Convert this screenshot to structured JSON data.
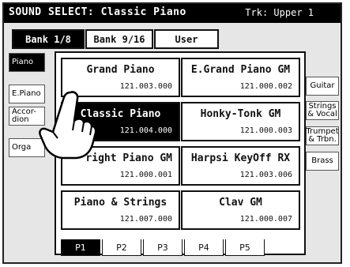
{
  "header": {
    "title": "SOUND SELECT: Classic Piano",
    "track": "Trk: Upper 1"
  },
  "bank_tabs": [
    {
      "label": "Bank 1/8",
      "active": true
    },
    {
      "label": "Bank 9/16",
      "active": false
    },
    {
      "label": "User",
      "active": false
    }
  ],
  "categories_left": [
    {
      "label": "Piano",
      "active": true
    },
    {
      "label": "E.Piano",
      "active": false
    },
    {
      "label": "Accor-\ndion",
      "active": false
    },
    {
      "label": "Orga",
      "active": false
    }
  ],
  "categories_right": [
    {
      "label": "Guitar"
    },
    {
      "label": "Strings\n& Vocal"
    },
    {
      "label": "Trumpet\n& Trbn."
    },
    {
      "label": "Brass"
    }
  ],
  "sounds": [
    {
      "name": "Grand Piano",
      "code": "121.003.000",
      "selected": false
    },
    {
      "name": "E.Grand Piano GM",
      "code": "121.000.002",
      "selected": false
    },
    {
      "name": "Classic Piano",
      "code": "121.004.000",
      "selected": true
    },
    {
      "name": "Honky-Tonk GM",
      "code": "121.000.003",
      "selected": false
    },
    {
      "name": "right Piano GM",
      "code": "121.000.001",
      "selected": false
    },
    {
      "name": "Harpsi KeyOff RX",
      "code": "121.003.006",
      "selected": false
    },
    {
      "name": "Piano & Strings",
      "code": "121.007.000",
      "selected": false
    },
    {
      "name": "Clav GM",
      "code": "121.000.007",
      "selected": false
    }
  ],
  "pages": [
    {
      "label": "P1",
      "active": true
    },
    {
      "label": "P2",
      "active": false
    },
    {
      "label": "P3",
      "active": false
    },
    {
      "label": "P4",
      "active": false
    },
    {
      "label": "P5",
      "active": false
    }
  ],
  "icons": {
    "pointer": "pointing-hand-icon"
  }
}
